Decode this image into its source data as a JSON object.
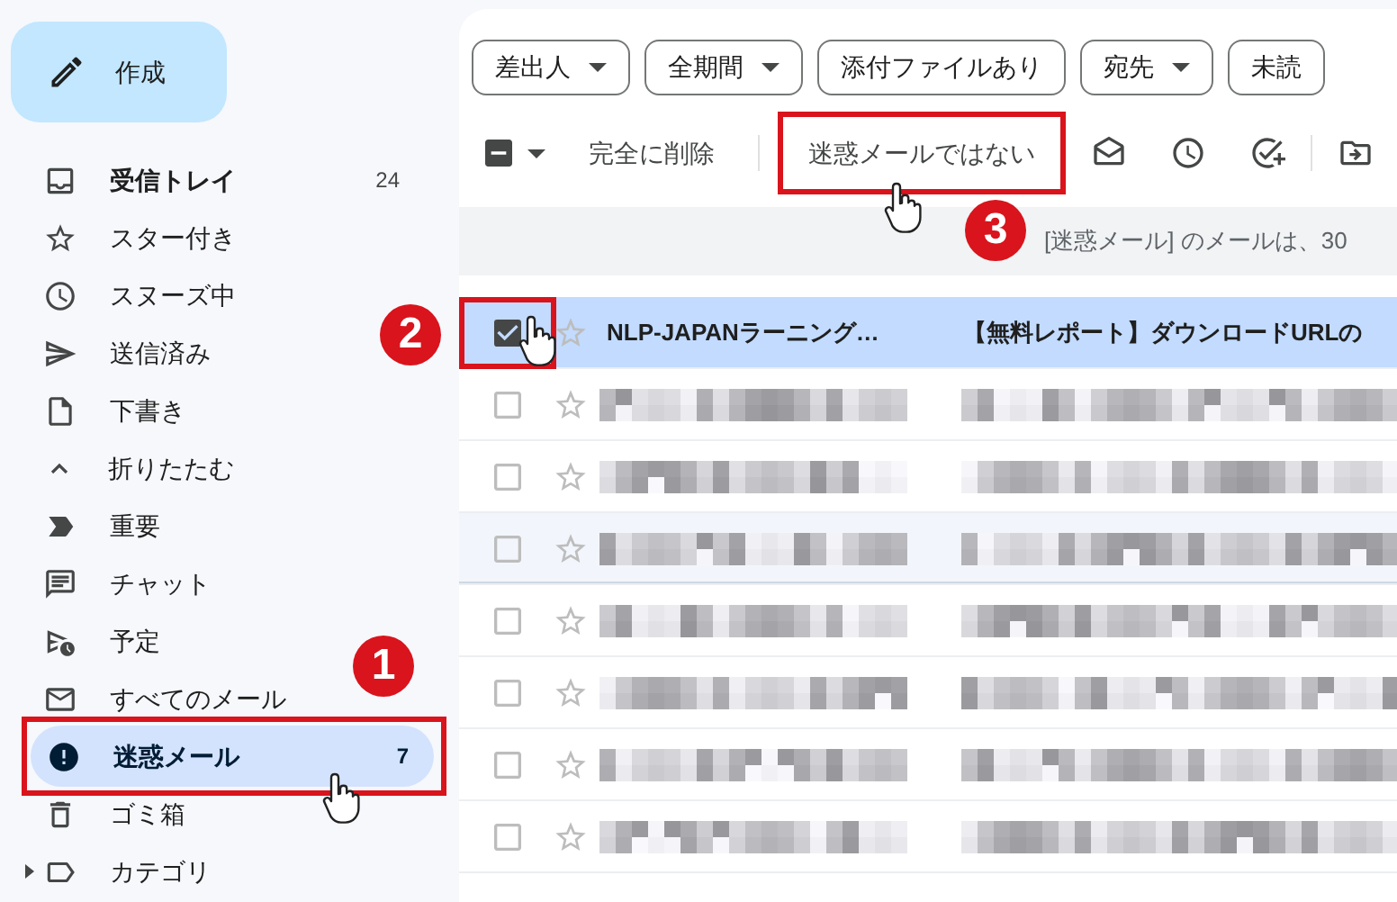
{
  "compose": {
    "label": "作成"
  },
  "sidebar": {
    "items": [
      {
        "kind": "item",
        "label": "受信トレイ",
        "count": "24",
        "unread": true,
        "selected": false
      },
      {
        "kind": "item",
        "label": "スター付き",
        "unread": false,
        "selected": false
      },
      {
        "kind": "item",
        "label": "スヌーズ中",
        "unread": false,
        "selected": false
      },
      {
        "kind": "item",
        "label": "送信済み",
        "unread": false,
        "selected": false
      },
      {
        "kind": "item",
        "label": "下書き",
        "unread": false,
        "selected": false
      },
      {
        "kind": "toggle",
        "label": "折りたたむ",
        "unread": false,
        "selected": false
      },
      {
        "kind": "item",
        "label": "重要",
        "unread": false,
        "selected": false
      },
      {
        "kind": "item",
        "label": "チャット",
        "unread": false,
        "selected": false
      },
      {
        "kind": "item",
        "label": "予定",
        "unread": false,
        "selected": false
      },
      {
        "kind": "item",
        "label": "すべてのメール",
        "unread": false,
        "selected": false
      },
      {
        "kind": "item",
        "label": "迷惑メール",
        "count": "7",
        "unread": true,
        "selected": true,
        "callout": "1"
      },
      {
        "kind": "item",
        "label": "ゴミ箱",
        "unread": false,
        "selected": false
      },
      {
        "kind": "group",
        "label": "カテゴリ",
        "unread": false,
        "selected": false,
        "expanded": false
      }
    ]
  },
  "filters": [
    {
      "label": "差出人",
      "dropdown": true
    },
    {
      "label": "全期間",
      "dropdown": true
    },
    {
      "label": "添付ファイルあり",
      "dropdown": false
    },
    {
      "label": "宛先",
      "dropdown": true
    },
    {
      "label": "未読",
      "dropdown": false
    }
  ],
  "toolbar": {
    "select_all": {
      "checked": true,
      "partial": true
    },
    "delete_forever": "完全に削除",
    "not_spam": {
      "label": "迷惑メールではない",
      "callout": "3"
    }
  },
  "banner": {
    "text": "[迷惑メール] のメールは、30"
  },
  "messages": [
    {
      "kind": "mail",
      "sender": "NLP-JAPANラーニング…",
      "subject": "【無料レポート】ダウンロードURLの",
      "checked": true,
      "selected": true,
      "hovered": false,
      "callout": "2"
    },
    {
      "kind": "blurred",
      "checked": false,
      "selected": false,
      "hovered": false
    },
    {
      "kind": "blurred",
      "checked": false,
      "selected": false,
      "hovered": false
    },
    {
      "kind": "blurred",
      "checked": false,
      "selected": false,
      "hovered": true
    },
    {
      "kind": "blurred",
      "checked": false,
      "selected": false,
      "hovered": false
    },
    {
      "kind": "blurred",
      "checked": false,
      "selected": false,
      "hovered": false
    },
    {
      "kind": "blurred",
      "checked": false,
      "selected": false,
      "hovered": false
    },
    {
      "kind": "blurred",
      "checked": false,
      "selected": false,
      "hovered": false
    }
  ]
}
